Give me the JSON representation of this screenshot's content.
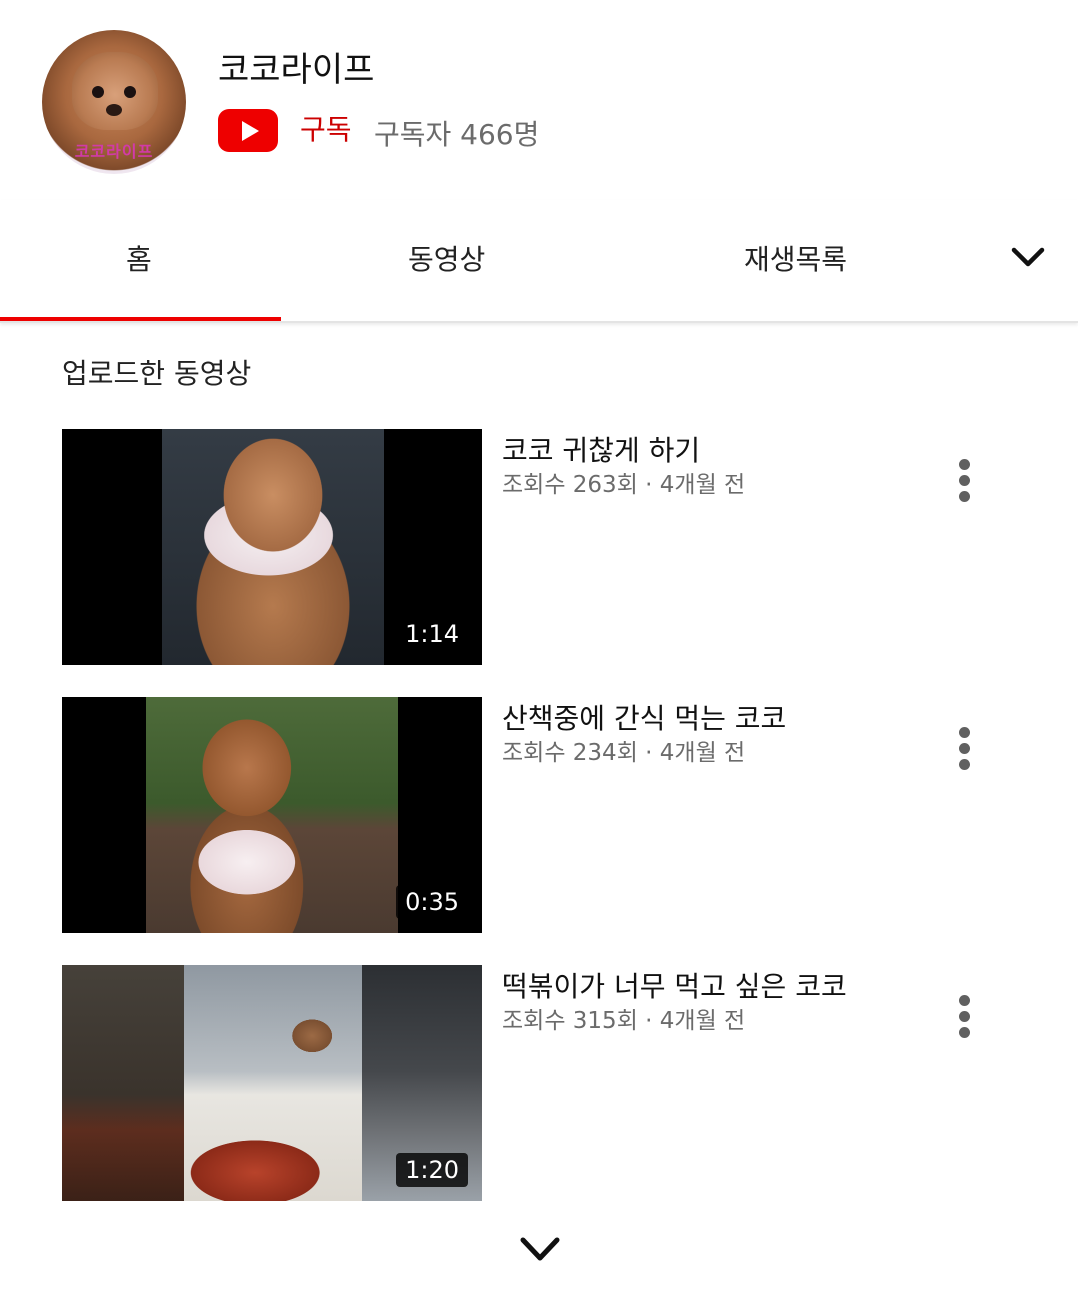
{
  "channel": {
    "avatar_text": "코코라이프",
    "name": "코코라이프",
    "subscribe_label": "구독",
    "subscriber_count": "구독자 466명"
  },
  "tabs": [
    {
      "label": "홈",
      "active": true
    },
    {
      "label": "동영상",
      "active": false
    },
    {
      "label": "재생목록",
      "active": false
    }
  ],
  "section_title": "업로드한 동영상",
  "videos": [
    {
      "title": "코코 귀찮게 하기",
      "meta": "조회수 263회 · 4개월 전",
      "duration": "1:14"
    },
    {
      "title": "산책중에 간식 먹는 코코",
      "meta": "조회수 234회 · 4개월 전",
      "duration": "0:35"
    },
    {
      "title": "떡볶이가 너무 먹고 싶은 코코",
      "meta": "조회수 315회 · 4개월 전",
      "duration": "1:20"
    }
  ],
  "icons": {
    "youtube": "youtube-logo-icon",
    "more_tabs": "chevron-down-icon",
    "video_menu": "more-vertical-icon",
    "load_more": "chevron-down-icon"
  },
  "colors": {
    "accent": "#ee0000",
    "subscribe_text": "#cc0000",
    "secondary_text": "#6b6b6b"
  }
}
